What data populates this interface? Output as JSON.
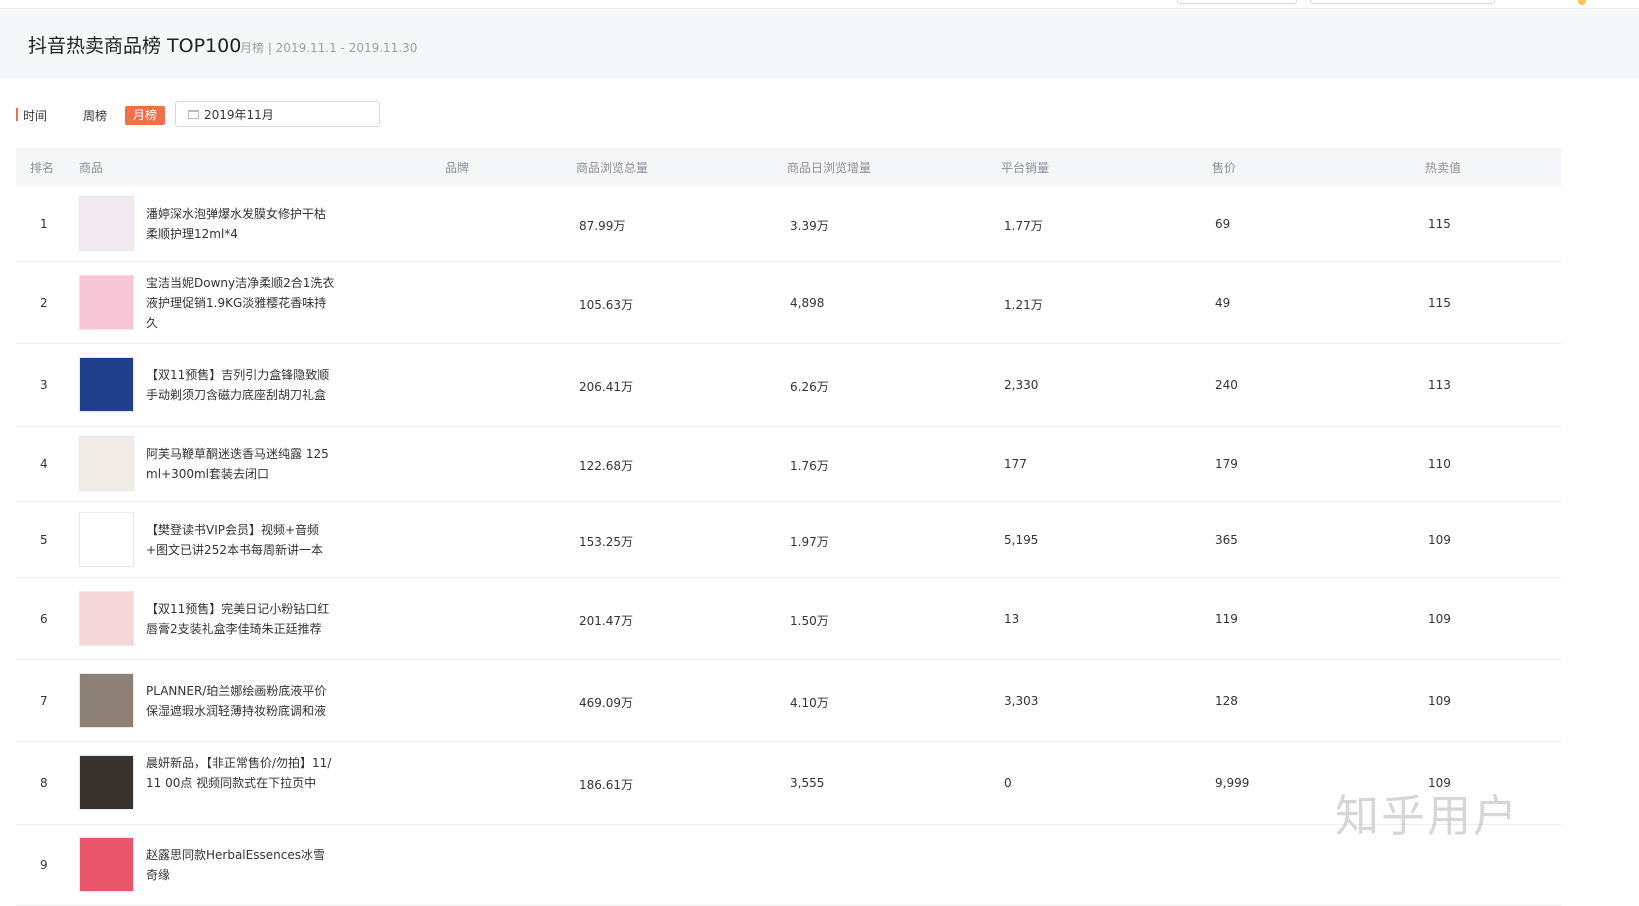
{
  "header": {
    "title": "抖音热卖商品榜 TOP100",
    "subtitle": "月榜 | 2019.11.1 - 2019.11.30"
  },
  "filter": {
    "label": "时间",
    "week": "周榜",
    "month": "月榜",
    "date_value": "2019年11月"
  },
  "columns": {
    "rank": "排名",
    "product": "商品",
    "brand": "品牌",
    "total_views": "商品浏览总量",
    "daily_views": "商品日浏览增量",
    "sales": "平台销量",
    "price": "售价",
    "hot": "热卖值"
  },
  "rows": [
    {
      "rank": "1",
      "name": "潘婷深水泡弹爆水发膜女修护干枯柔顺护理12ml*4",
      "total_views": "87.99万",
      "daily_views": "3.39万",
      "sales": "1.77万",
      "price": "69",
      "hot": "115",
      "thumb_color": "#f3e9f1"
    },
    {
      "rank": "2",
      "name": "宝洁当妮Downy洁净柔顺2合1洗衣液护理促销1.9KG淡雅樱花香味持久",
      "total_views": "105.63万",
      "daily_views": "4,898",
      "sales": "1.21万",
      "price": "49",
      "hot": "115",
      "thumb_color": "#f7c6d6"
    },
    {
      "rank": "3",
      "name": "【双11预售】吉列引力盒锋隐致顺手动剃须刀含磁力底座刮胡刀礼盒",
      "total_views": "206.41万",
      "daily_views": "6.26万",
      "sales": "2,330",
      "price": "240",
      "hot": "113",
      "thumb_color": "#1f3f8a"
    },
    {
      "rank": "4",
      "name": "阿芙马鞭草酮迷迭香马迷纯露 125ml+300ml套装去闭口",
      "total_views": "122.68万",
      "daily_views": "1.76万",
      "sales": "177",
      "price": "179",
      "hot": "110",
      "thumb_color": "#f2ece6"
    },
    {
      "rank": "5",
      "name": "【樊登读书VIP会员】视频+音频+图文已讲252本书每周新讲一本",
      "total_views": "153.25万",
      "daily_views": "1.97万",
      "sales": "5,195",
      "price": "365",
      "hot": "109",
      "thumb_color": "#ffffff"
    },
    {
      "rank": "6",
      "name": "【双11预售】完美日记小粉钻口红唇膏2支装礼盒李佳琦朱正廷推荐",
      "total_views": "201.47万",
      "daily_views": "1.50万",
      "sales": "13",
      "price": "119",
      "hot": "109",
      "thumb_color": "#f6d7d9"
    },
    {
      "rank": "7",
      "name": "PLANNER/珀兰娜绘画粉底液平价保湿遮瑕水润轻薄持妆粉底调和液",
      "total_views": "469.09万",
      "daily_views": "4.10万",
      "sales": "3,303",
      "price": "128",
      "hot": "109",
      "thumb_color": "#8c7f74"
    },
    {
      "rank": "8",
      "name": "晨妍新品，【非正常售价/勿拍】11/11 00点 视频同款式在下拉页中",
      "total_views": "186.61万",
      "daily_views": "3,555",
      "sales": "0",
      "price": "9,999",
      "hot": "109",
      "thumb_color": "#3a332d"
    },
    {
      "rank": "9",
      "name": "赵露思同款HerbalEssences冰雪奇缘",
      "total_views": "",
      "daily_views": "",
      "sales": "",
      "price": "",
      "hot": "",
      "thumb_color": "#e9566b"
    }
  ],
  "watermark": "知乎用户"
}
